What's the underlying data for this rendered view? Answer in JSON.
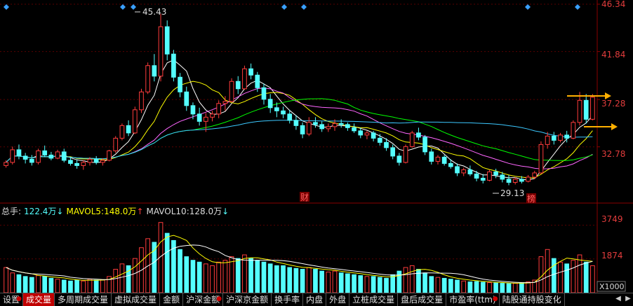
{
  "price_axis": {
    "labels": [
      "46.34",
      "41.84",
      "37.28",
      "32.78"
    ],
    "values": [
      46.34,
      41.84,
      37.28,
      32.78
    ],
    "color": "#e23c3c"
  },
  "volume_axis": {
    "labels": [
      "3749",
      "1874"
    ],
    "values": [
      3749,
      1874
    ],
    "unit_label": "X1000"
  },
  "annotations": {
    "high_label": "45.43",
    "low_label": "29.13",
    "badge_finance": "财",
    "badge_rank": "榜"
  },
  "volume_header": {
    "total_label": "总手:",
    "total_value": "122.4万",
    "total_arrow": "↓",
    "ma5_label": "MAVOL5:",
    "ma5_value": "148.0万",
    "ma5_arrow": "↑",
    "ma10_label": "MAVOL10:",
    "ma10_value": "128.0万",
    "ma10_arrow": "↓"
  },
  "tabs": [
    {
      "label": "设置",
      "dot": true,
      "active": false
    },
    {
      "label": "成交量",
      "dot": false,
      "active": true
    },
    {
      "label": "多周期成交量",
      "dot": false,
      "active": false
    },
    {
      "label": "虚拟成交量",
      "dot": false,
      "active": false
    },
    {
      "label": "金额",
      "dot": false,
      "active": false
    },
    {
      "label": "沪深金额",
      "dot": true,
      "active": false
    },
    {
      "label": "沪深京金额",
      "dot": false,
      "active": false
    },
    {
      "label": "换手率",
      "dot": false,
      "active": false
    },
    {
      "label": "内盘",
      "dot": false,
      "active": false
    },
    {
      "label": "外盘",
      "dot": false,
      "active": false
    },
    {
      "label": "立桩成交量",
      "dot": false,
      "active": false
    },
    {
      "label": "盘后成交量",
      "dot": false,
      "active": false
    },
    {
      "label": "市盈率(ttm)",
      "dot": true,
      "active": false
    },
    {
      "label": "陆股通持股变化",
      "dot": false,
      "active": false
    }
  ],
  "colors": {
    "up": "#ff3c3c",
    "down": "#54ffff",
    "ma5": "#ffffff",
    "ma10": "#ffff00",
    "ma20": "#ff66ff",
    "ma30": "#00ff00",
    "ma60": "#3cc8ff",
    "arrow": "#ffb000"
  },
  "chart_data": {
    "type": "candlestick",
    "ylim": [
      27.5,
      46.34
    ],
    "candles": [
      [
        31.0,
        31.5,
        30.8,
        31.3
      ],
      [
        31.3,
        32.8,
        31.1,
        32.5
      ],
      [
        32.5,
        33.0,
        31.6,
        31.9
      ],
      [
        31.9,
        32.2,
        31.2,
        31.6
      ],
      [
        31.6,
        32.0,
        31.0,
        31.3
      ],
      [
        31.3,
        32.6,
        31.1,
        32.4
      ],
      [
        32.4,
        32.9,
        31.8,
        32.0
      ],
      [
        32.0,
        32.3,
        31.5,
        31.7
      ],
      [
        31.7,
        32.5,
        31.6,
        32.3
      ],
      [
        32.3,
        32.6,
        31.3,
        31.5
      ],
      [
        31.5,
        31.8,
        31.0,
        31.2
      ],
      [
        31.2,
        31.6,
        30.7,
        31.0
      ],
      [
        31.0,
        31.5,
        30.6,
        31.3
      ],
      [
        31.3,
        31.8,
        31.0,
        31.6
      ],
      [
        31.6,
        31.9,
        31.1,
        31.3
      ],
      [
        31.3,
        31.7,
        31.0,
        31.5
      ],
      [
        31.5,
        32.5,
        31.4,
        32.4
      ],
      [
        32.4,
        33.8,
        32.2,
        33.6
      ],
      [
        33.6,
        35.0,
        33.4,
        34.8
      ],
      [
        34.8,
        35.3,
        33.8,
        34.1
      ],
      [
        34.1,
        36.6,
        34.0,
        36.3
      ],
      [
        36.3,
        38.3,
        36.0,
        38.0
      ],
      [
        38.0,
        40.8,
        37.8,
        40.5
      ],
      [
        40.5,
        41.6,
        39.0,
        39.5
      ],
      [
        39.5,
        45.43,
        39.0,
        44.2
      ],
      [
        44.2,
        44.8,
        41.0,
        41.6
      ],
      [
        41.6,
        42.0,
        39.0,
        39.4
      ],
      [
        39.4,
        39.8,
        37.5,
        38.0
      ],
      [
        38.0,
        38.5,
        36.2,
        36.7
      ],
      [
        36.7,
        37.0,
        35.4,
        35.9
      ],
      [
        35.9,
        36.5,
        34.8,
        35.2
      ],
      [
        35.2,
        36.0,
        34.2,
        35.6
      ],
      [
        35.6,
        36.2,
        35.2,
        35.9
      ],
      [
        35.9,
        37.2,
        35.5,
        36.9
      ],
      [
        36.9,
        37.6,
        36.2,
        37.1
      ],
      [
        37.1,
        39.3,
        37.0,
        39.0
      ],
      [
        39.0,
        39.5,
        37.8,
        38.3
      ],
      [
        38.3,
        40.5,
        38.2,
        40.2
      ],
      [
        40.2,
        40.7,
        39.2,
        39.6
      ],
      [
        39.6,
        39.9,
        38.0,
        38.4
      ],
      [
        38.4,
        38.8,
        36.8,
        37.3
      ],
      [
        37.3,
        37.8,
        36.0,
        36.5
      ],
      [
        36.5,
        37.0,
        35.6,
        36.2
      ],
      [
        36.2,
        36.6,
        35.5,
        35.9
      ],
      [
        35.9,
        36.3,
        35.0,
        35.3
      ],
      [
        35.3,
        35.8,
        34.4,
        34.8
      ],
      [
        34.8,
        35.1,
        33.6,
        34.0
      ],
      [
        34.0,
        35.6,
        33.8,
        35.1
      ],
      [
        35.1,
        35.6,
        34.6,
        34.9
      ],
      [
        34.9,
        35.2,
        34.2,
        34.5
      ],
      [
        34.5,
        35.0,
        34.2,
        34.7
      ],
      [
        34.7,
        35.4,
        34.3,
        35.0
      ],
      [
        35.0,
        35.4,
        34.6,
        34.9
      ],
      [
        34.9,
        35.1,
        34.3,
        34.6
      ],
      [
        34.6,
        35.0,
        34.1,
        34.3
      ],
      [
        34.3,
        34.6,
        33.6,
        33.9
      ],
      [
        33.9,
        34.3,
        33.5,
        34.1
      ],
      [
        34.1,
        34.3,
        33.3,
        33.6
      ],
      [
        33.6,
        34.0,
        32.9,
        33.2
      ],
      [
        33.2,
        33.6,
        32.4,
        32.7
      ],
      [
        32.7,
        33.0,
        31.6,
        31.9
      ],
      [
        31.9,
        32.2,
        31.0,
        31.3
      ],
      [
        31.3,
        33.0,
        31.2,
        32.8
      ],
      [
        32.8,
        34.3,
        32.7,
        34.1
      ],
      [
        34.1,
        34.6,
        33.4,
        33.7
      ],
      [
        33.7,
        33.9,
        32.0,
        32.3
      ],
      [
        32.3,
        32.6,
        31.1,
        31.4
      ],
      [
        31.4,
        32.0,
        31.1,
        31.8
      ],
      [
        31.8,
        32.0,
        31.0,
        31.2
      ],
      [
        31.2,
        31.6,
        30.7,
        30.9
      ],
      [
        30.9,
        31.2,
        30.0,
        30.3
      ],
      [
        30.3,
        30.8,
        30.0,
        30.6
      ],
      [
        30.6,
        31.0,
        30.0,
        30.2
      ],
      [
        30.2,
        30.5,
        29.5,
        29.8
      ],
      [
        29.8,
        30.2,
        29.3,
        29.6
      ],
      [
        29.6,
        30.6,
        29.5,
        30.4
      ],
      [
        30.4,
        30.7,
        29.8,
        30.1
      ],
      [
        30.1,
        30.4,
        29.4,
        29.7
      ],
      [
        29.7,
        30.1,
        29.13,
        29.4
      ],
      [
        29.4,
        29.9,
        29.2,
        29.7
      ],
      [
        29.7,
        30.0,
        29.3,
        29.5
      ],
      [
        29.5,
        30.1,
        29.4,
        29.9
      ],
      [
        29.9,
        30.5,
        29.7,
        30.3
      ],
      [
        30.3,
        33.3,
        30.2,
        33.0
      ],
      [
        33.0,
        34.2,
        32.6,
        33.8
      ],
      [
        33.8,
        34.2,
        33.0,
        33.4
      ],
      [
        33.4,
        34.1,
        33.2,
        33.9
      ],
      [
        33.9,
        34.3,
        33.2,
        33.6
      ],
      [
        33.6,
        35.3,
        33.5,
        35.1
      ],
      [
        35.1,
        38.0,
        34.8,
        37.2
      ],
      [
        37.2,
        37.8,
        35.0,
        35.4
      ],
      [
        35.4,
        37.8,
        35.3,
        37.5
      ]
    ],
    "volumes": [
      1400,
      1100,
      1000,
      900,
      850,
      950,
      900,
      800,
      750,
      700,
      650,
      700,
      650,
      750,
      700,
      700,
      900,
      1300,
      1600,
      1500,
      1900,
      2500,
      3000,
      2800,
      3900,
      3300,
      2900,
      2400,
      2000,
      1800,
      1700,
      1600,
      1500,
      1700,
      1800,
      2000,
      1900,
      2100,
      1900,
      1800,
      1700,
      1600,
      1500,
      1500,
      1400,
      1350,
      1300,
      1400,
      1300,
      1200,
      1150,
      1200,
      1100,
      1050,
      1000,
      950,
      900,
      900,
      850,
      800,
      1000,
      1200,
      1400,
      1500,
      1300,
      1100,
      900,
      850,
      800,
      750,
      700,
      650,
      600,
      620,
      580,
      560,
      540,
      520,
      500,
      520,
      560,
      600,
      700,
      2000,
      2400,
      1900,
      1700,
      1600,
      1800,
      2100,
      1700,
      1500
    ]
  }
}
